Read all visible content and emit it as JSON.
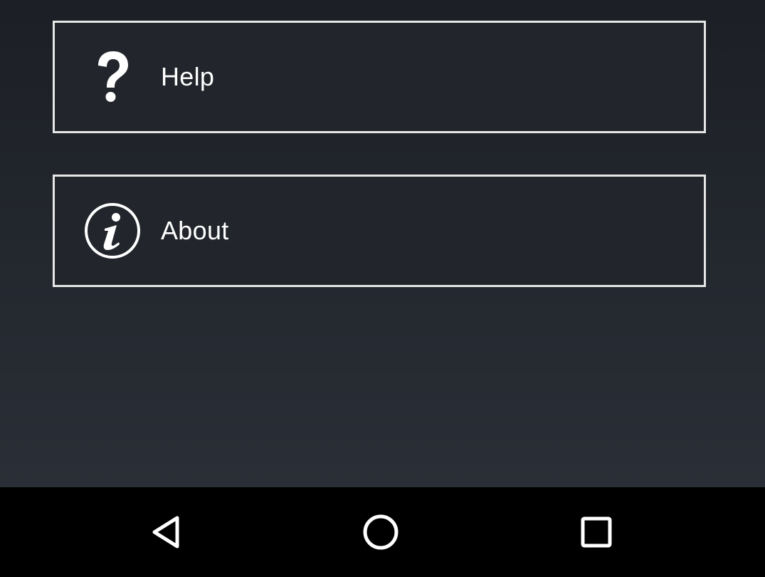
{
  "menu": {
    "items": [
      {
        "label": "Help",
        "icon": "question-icon"
      },
      {
        "label": "About",
        "icon": "info-icon"
      }
    ]
  },
  "navbar": {
    "back_icon": "back-triangle-icon",
    "home_icon": "home-circle-icon",
    "recents_icon": "recents-square-icon"
  },
  "colors": {
    "background_top": "#1c1f25",
    "background_bottom": "#2a2f37",
    "border": "#e6e6e6",
    "text": "#ffffff",
    "navbar": "#000000"
  }
}
